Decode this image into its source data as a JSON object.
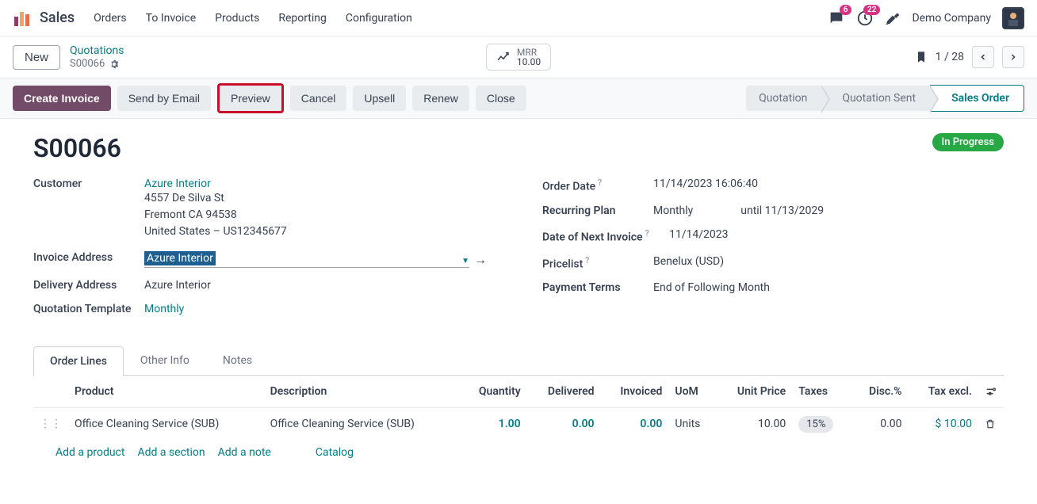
{
  "topnav": {
    "brand": "Sales",
    "menu": [
      "Orders",
      "To Invoice",
      "Products",
      "Reporting",
      "Configuration"
    ],
    "chat_badge": "6",
    "activity_badge": "22",
    "company": "Demo Company"
  },
  "breadcrumb": {
    "new_label": "New",
    "top": "Quotations",
    "sub": "S00066",
    "mrr_label": "MRR",
    "mrr_value": "10.00",
    "pager": "1 / 28"
  },
  "actions": {
    "create_invoice": "Create Invoice",
    "send_email": "Send by Email",
    "preview": "Preview",
    "cancel": "Cancel",
    "upsell": "Upsell",
    "renew": "Renew",
    "close": "Close"
  },
  "status_flow": [
    "Quotation",
    "Quotation Sent",
    "Sales Order"
  ],
  "doc": {
    "title": "S00066",
    "badge": "In Progress"
  },
  "fields_left": {
    "customer_label": "Customer",
    "customer_name": "Azure Interior",
    "addr1": "4557 De Silva St",
    "addr2": "Fremont CA 94538",
    "addr3": "United States – US12345677",
    "invoice_addr_label": "Invoice Address",
    "invoice_addr_value": "Azure Interior",
    "delivery_addr_label": "Delivery Address",
    "delivery_addr_value": "Azure Interior",
    "quotation_tpl_label": "Quotation Template",
    "quotation_tpl_value": "Monthly"
  },
  "fields_right": {
    "order_date_label": "Order Date",
    "order_date_value": "11/14/2023 16:06:40",
    "recurring_label": "Recurring Plan",
    "recurring_value": "Monthly",
    "until_label": "until",
    "until_value": "11/13/2029",
    "next_invoice_label": "Date of Next Invoice",
    "next_invoice_value": "11/14/2023",
    "pricelist_label": "Pricelist",
    "pricelist_value": "Benelux (USD)",
    "payment_terms_label": "Payment Terms",
    "payment_terms_value": "End of Following Month"
  },
  "tabs": [
    "Order Lines",
    "Other Info",
    "Notes"
  ],
  "table": {
    "headers": {
      "product": "Product",
      "description": "Description",
      "quantity": "Quantity",
      "delivered": "Delivered",
      "invoiced": "Invoiced",
      "uom": "UoM",
      "unit_price": "Unit Price",
      "taxes": "Taxes",
      "disc": "Disc.%",
      "tax_excl": "Tax excl."
    },
    "rows": [
      {
        "product": "Office Cleaning Service (SUB)",
        "description": "Office Cleaning Service (SUB)",
        "quantity": "1.00",
        "delivered": "0.00",
        "invoiced": "0.00",
        "uom": "Units",
        "unit_price": "10.00",
        "taxes": "15%",
        "disc": "0.00",
        "tax_excl": "$ 10.00"
      }
    ],
    "add_product": "Add a product",
    "add_section": "Add a section",
    "add_note": "Add a note",
    "catalog": "Catalog"
  }
}
